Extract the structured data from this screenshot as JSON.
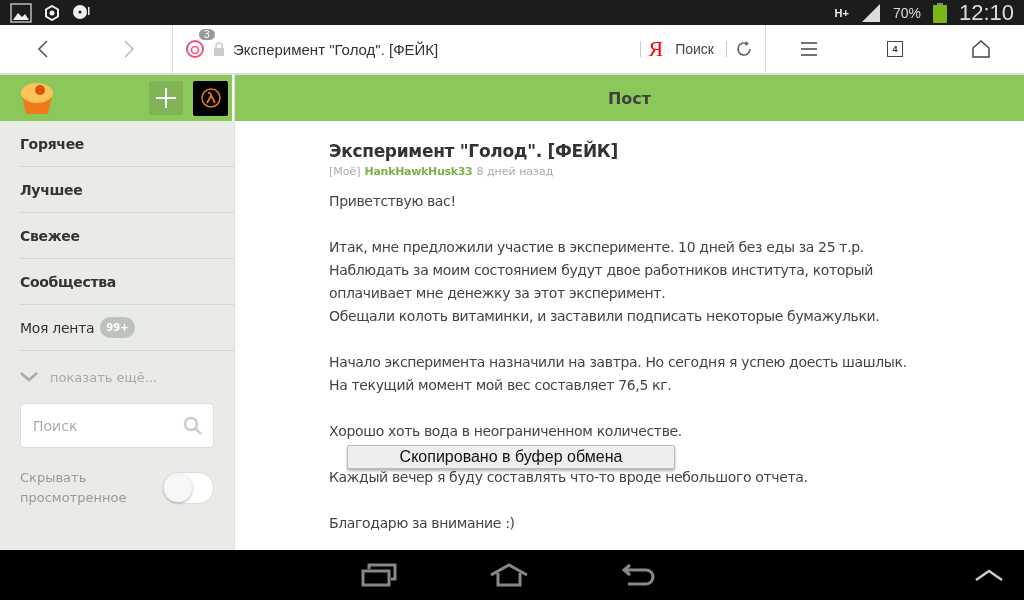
{
  "status_bar": {
    "network": "H+",
    "battery": "70%",
    "time": "12:10"
  },
  "browser": {
    "tab_count": "3",
    "page_title": "Эксперимент \"Голод\". [ФЕЙК]",
    "search_logo": "Я",
    "search_label": "Поиск",
    "tabs_open": "4"
  },
  "header": {
    "title": "Пост"
  },
  "sidebar": {
    "items": [
      {
        "label": "Горячее",
        "kind": "bold"
      },
      {
        "label": "Лучшее",
        "kind": "bold"
      },
      {
        "label": "Свежее",
        "kind": "bold"
      },
      {
        "label": "Сообщества",
        "kind": "bold"
      },
      {
        "label": "Моя лента",
        "kind": "feed",
        "badge": "99+"
      }
    ],
    "show_more": "показать ещё...",
    "search": {
      "placeholder": "Поиск"
    },
    "hide_viewed": {
      "label": "Скрывать просмотренное",
      "on": false
    }
  },
  "post": {
    "title": "Эксперимент \"Голод\". [ФЕЙК]",
    "tag": "[Моё]",
    "author": "HankHawkHusk33",
    "time": "8 дней назад",
    "paragraphs": [
      [
        "Приветствую вас!"
      ],
      [
        "Итак, мне предложили участие в эксперименте. 10 дней без еды за 25 т.р.",
        "Наблюдать за моим состоянием будут двое работников института, который",
        "оплачивает мне денежку за этот эксперимент.",
        "Обещали колоть витаминки, и заставили подписать некоторые бумажульки."
      ],
      [
        "Начало эксперимента назначили на завтра. Но сегодня я успею доесть шашлык.",
        "На текущий момент мой вес составляет 76,5 кг."
      ],
      [
        "Хорошо хоть вода в неограниченном количестве."
      ],
      [
        "Каждый вечер я буду составлять что-то вроде небольшого отчета."
      ],
      [
        "Благодарю за внимание :)"
      ]
    ]
  },
  "toast": {
    "text": "Скопировано в буфер обмена"
  }
}
